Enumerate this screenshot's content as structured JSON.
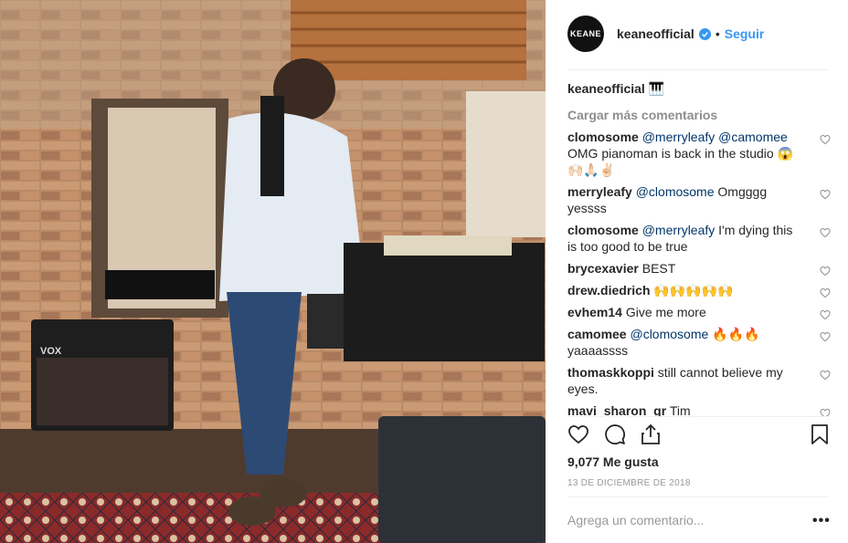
{
  "post": {
    "username": "keaneofficial",
    "avatar_text": "KEANE",
    "dot": "•",
    "follow_label": "Seguir",
    "caption_user": "keaneofficial",
    "caption_emoji": "🎹",
    "load_more": "Cargar más comentarios",
    "likes": "9,077 Me gusta",
    "date": "13 DE DICIEMBRE DE 2018",
    "add_comment_placeholder": "Agrega un comentario...",
    "more_options": "•••",
    "colors": {
      "link": "#3897f0",
      "mention": "#003569",
      "muted": "#8e8e8e"
    }
  },
  "comments": [
    {
      "user": "clomosome",
      "mention": "@merryleafy @camomee",
      "text": " OMG pianoman is back in the studio 😱 🙌🏻🙏🏻✌🏻"
    },
    {
      "user": "merryleafy",
      "mention": "@clomosome",
      "text": " Omgggg yessss"
    },
    {
      "user": "clomosome",
      "mention": "@merryleafy",
      "text": " I'm dying this is too good to be true"
    },
    {
      "user": "brycexavier",
      "mention": "",
      "text": "BEST"
    },
    {
      "user": "drew.diedrich",
      "mention": "",
      "text": "🙌🙌🙌🙌🙌"
    },
    {
      "user": "evhem14",
      "mention": "",
      "text": "Give me more"
    },
    {
      "user": "camomee",
      "mention": "@clomosome",
      "text": " 🔥🔥🔥 yaaaassss"
    },
    {
      "user": "thomaskkoppi",
      "mention": "",
      "text": "still cannot believe my eyes."
    },
    {
      "user": "mavi_sharon_gr",
      "mention": "",
      "text": "Tim"
    }
  ],
  "photo": {
    "amp_brand": "VOX"
  },
  "icons": [
    "heart-icon",
    "comment-icon",
    "share-icon",
    "bookmark-icon",
    "verified-badge-icon"
  ]
}
